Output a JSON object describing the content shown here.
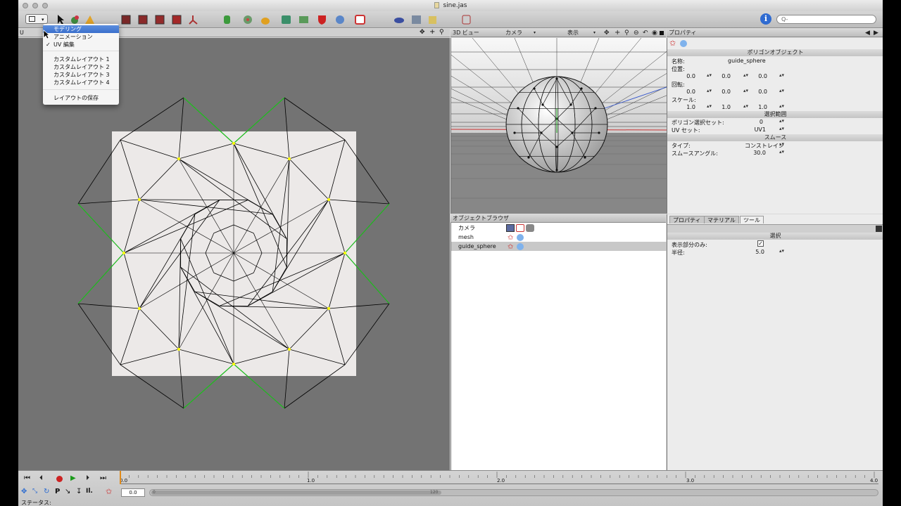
{
  "window": {
    "title": "sine.jas"
  },
  "toolbar": {
    "search_placeholder": "Q-",
    "info_label": "i"
  },
  "layout_menu": {
    "items": [
      {
        "label": "モデリング",
        "selected": true,
        "checked": false
      },
      {
        "label": "アニメーション",
        "selected": false,
        "checked": false
      },
      {
        "label": "UV 編集",
        "selected": false,
        "checked": true
      }
    ],
    "custom_items": [
      "カスタムレイアウト 1",
      "カスタムレイアウト 2",
      "カスタムレイアウト 3",
      "カスタムレイアウト 4"
    ],
    "save_label": "レイアウトの保存"
  },
  "uv_header": {
    "label": "U"
  },
  "viewport": {
    "title": "3D ビュー",
    "camera_menu": "カメラ",
    "display_menu": "表示"
  },
  "object_browser": {
    "title": "オブジェクトブラウザ",
    "items": [
      {
        "name": "カメラ",
        "selected": false
      },
      {
        "name": "mesh",
        "selected": false
      },
      {
        "name": "guide_sphere",
        "selected": true
      }
    ]
  },
  "properties": {
    "title": "プロパティ",
    "section_object": "ポリゴンオブジェクト",
    "name_label": "名称:",
    "name_value": "guide_sphere",
    "position_label": "位置:",
    "position": [
      "0.0",
      "0.0",
      "0.0"
    ],
    "rotation_label": "回転:",
    "rotation": [
      "0.0",
      "0.0",
      "0.0"
    ],
    "scale_label": "スケール:",
    "scale": [
      "1.0",
      "1.0",
      "1.0"
    ],
    "section_selection": "選択範囲",
    "polyset_label": "ポリゴン選択セット:",
    "polyset_value": "0",
    "uvset_label": "UV セット:",
    "uvset_value": "UV1",
    "section_smooth": "スムース",
    "type_label": "タイプ:",
    "type_value": "コンストレイン",
    "angle_label": "スムースアングル:",
    "angle_value": "30.0"
  },
  "tools_panel": {
    "tabs": [
      "プロパティ",
      "マテリアル",
      "ツール"
    ],
    "active_tab": "ツール",
    "section_select": "選択",
    "visible_only_label": "表示部分のみ:",
    "visible_only_checked": true,
    "radius_label": "半径:",
    "radius_value": "5.0"
  },
  "timeline": {
    "ticks": [
      "0.0",
      "1.0",
      "2.0",
      "3.0",
      "4.0"
    ],
    "current_frame": "0.0",
    "scroll_start": "0",
    "scroll_end": "120",
    "status_label": "ステータス:"
  },
  "colors": {
    "uv_background": "#737373",
    "uv_sheet": "#ece9e8",
    "seam_green": "#1fbf1f",
    "vertex_yellow": "#ffff00",
    "selection_blue": "#3a6fcc"
  }
}
